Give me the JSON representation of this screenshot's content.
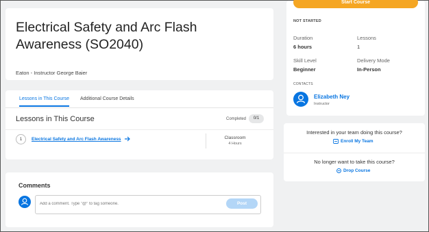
{
  "course": {
    "title": "Electrical Safety and Arc Flash Awareness (SO2040)",
    "provider": "Eaton - Instructor George Baier"
  },
  "tabs": [
    {
      "label": "Lessons in This Course"
    },
    {
      "label": "Additional Course Details"
    }
  ],
  "lessons_section": {
    "heading": "Lessons in This Course",
    "completed_label": "Completed",
    "completed_count": "0/1",
    "lessons": [
      {
        "number": "1",
        "title": "Electrical Safety and Arc Flash Awareness",
        "type": "Classroom",
        "duration": "4 Hours"
      }
    ]
  },
  "comments": {
    "heading": "Comments",
    "placeholder": "Add a comment. Type \"@\" to tag someone.",
    "post_label": "Post"
  },
  "summary": {
    "start_label": "Start Course",
    "status": "NOT STARTED",
    "duration_label": "Duration",
    "duration_value": "6 hours",
    "lessons_label": "Lessons",
    "lessons_value": "1",
    "skill_label": "Skill Level",
    "skill_value": "Beginner",
    "delivery_label": "Delivery Mode",
    "delivery_value": "In-Person",
    "contacts_label": "CONTACTS",
    "contact_name": "Elizabeth Ney",
    "contact_role": "Instructor"
  },
  "team": {
    "question": "Interested in your team doing this course?",
    "enroll_label": "Enroll My Team",
    "drop_question": "No longer want to take this course?",
    "drop_label": "Drop Course"
  },
  "colors": {
    "accent": "#0875e1",
    "start_button": "#f5a623",
    "background": "#f0f1f2"
  }
}
